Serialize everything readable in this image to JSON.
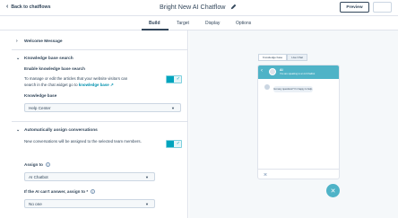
{
  "header": {
    "back_label": "Back to chatflows",
    "title": "Bright New AI Chatflow",
    "preview_label": "Preview"
  },
  "tabs": [
    {
      "label": "Build"
    },
    {
      "label": "Target"
    },
    {
      "label": "Display"
    },
    {
      "label": "Options"
    }
  ],
  "sections": {
    "welcome": {
      "title": "Welcome Message"
    },
    "kb": {
      "title": "Knowledge base search",
      "enable_label": "Enable knowledge base search",
      "desc_1": "To manage or edit the articles that your website visitors can",
      "desc_2": "search in the chat widget go to",
      "desc_link": "knowledge base",
      "kb_label": "Knowledge base",
      "kb_value": "Help Center",
      "enabled": true
    },
    "assign": {
      "title": "Automatically assign conversations",
      "desc": "New conversations will be assigned to the selected team members.",
      "assign_to_label": "Assign to",
      "assign_to_value": "AI Chatbot",
      "fallback_label": "If the AI can't answer, assign to *",
      "fallback_value": "No one",
      "enabled": true
    }
  },
  "preview": {
    "mini_tabs": [
      "Knowledge base",
      "Live Chat"
    ],
    "bot_name": "AI",
    "bot_subtitle": "You are speaking to an AI Chatbot",
    "bubble_text": "Got any questions? I'm happy to help."
  },
  "colors": {
    "accent": "#00a4bd",
    "widget_header": "#4fb3c7",
    "text": "#33475b"
  }
}
